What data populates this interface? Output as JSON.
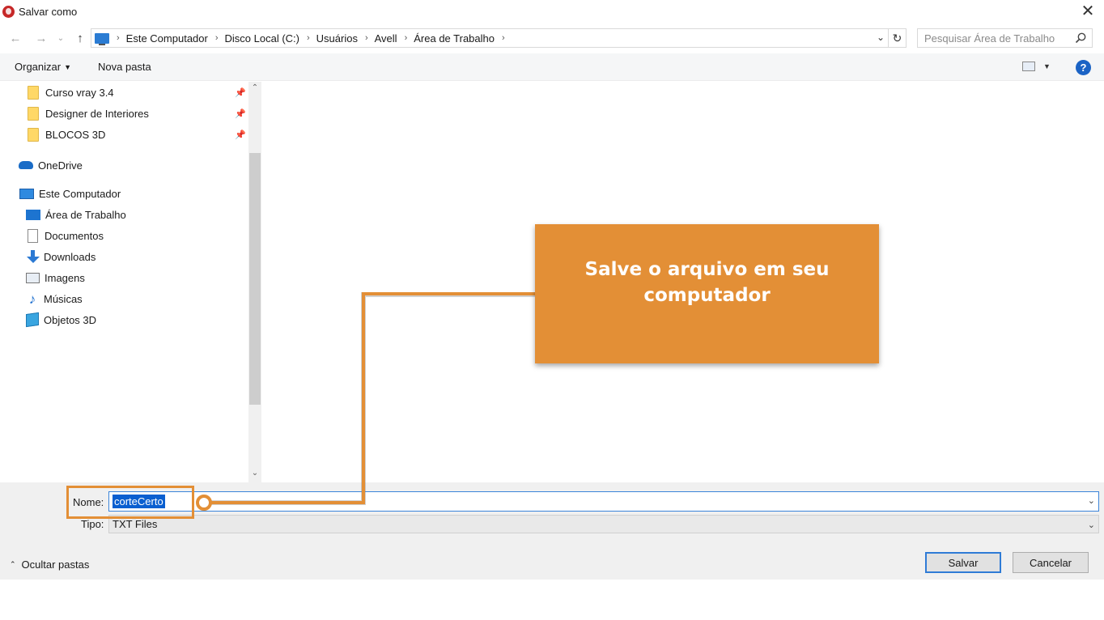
{
  "window": {
    "title": "Salvar como",
    "close_symbol": "✕"
  },
  "navigation": {
    "back_symbol": "←",
    "forward_symbol": "→",
    "recent_symbol": "⌄",
    "up_symbol": "↑"
  },
  "address": {
    "crumbs": [
      "Este Computador",
      "Disco Local (C:)",
      "Usuários",
      "Avell",
      "Área de Trabalho"
    ],
    "separator": "›",
    "dropdown_symbol": "⌄",
    "refresh_symbol": "↻"
  },
  "search": {
    "placeholder": "Pesquisar Área de Trabalho"
  },
  "toolbar": {
    "organize_label": "Organizar",
    "new_folder_label": "Nova pasta",
    "caret": "▼",
    "help_label": "?"
  },
  "sidebar": {
    "quick_access": [
      {
        "label": "Curso vray 3.4",
        "pinned": true
      },
      {
        "label": "Designer de Interiores",
        "pinned": true
      },
      {
        "label": "BLOCOS 3D",
        "pinned": true
      }
    ],
    "pin_symbol": "📌",
    "onedrive": "OneDrive",
    "this_pc": "Este Computador",
    "pc_items": [
      {
        "label": "Área de Trabalho",
        "icon": "desktop-icon"
      },
      {
        "label": "Documentos",
        "icon": "documents-icon"
      },
      {
        "label": "Downloads",
        "icon": "downloads-icon"
      },
      {
        "label": "Imagens",
        "icon": "pictures-icon"
      },
      {
        "label": "Músicas",
        "icon": "music-icon"
      },
      {
        "label": "Objetos 3D",
        "icon": "3d-objects-icon"
      }
    ],
    "scroll_up_symbol": "⌃",
    "scroll_down_symbol": "⌄"
  },
  "form": {
    "name_label": "Nome:",
    "name_value": "corteCerto",
    "type_label": "Tipo:",
    "type_value": "TXT Files",
    "chevron": "⌄"
  },
  "footer": {
    "hide_folders_symbol": "⌃",
    "hide_folders_label": "Ocultar pastas",
    "save_label": "Salvar",
    "cancel_label": "Cancelar"
  },
  "callout": {
    "text": "Salve o arquivo em seu computador",
    "color": "#e38f36"
  },
  "colors": {
    "accent": "#2f7bd6",
    "selection": "#0a5fd0",
    "callout": "#e38f36"
  }
}
